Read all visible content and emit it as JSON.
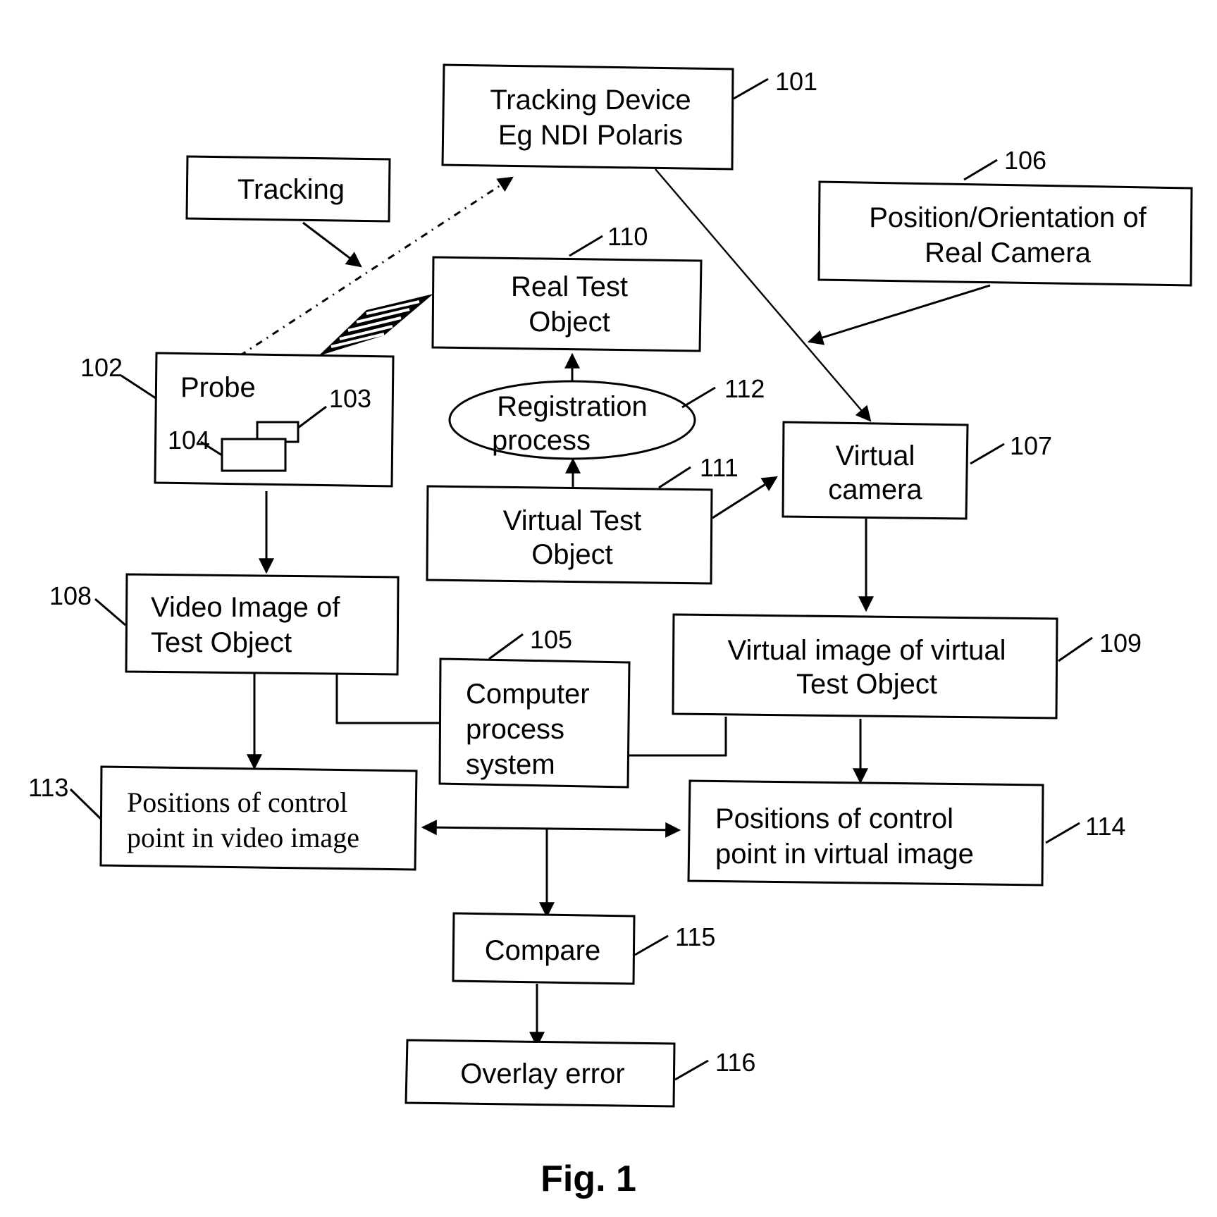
{
  "figure": {
    "caption": "Fig. 1"
  },
  "nodes": {
    "tracking_device": {
      "ref": "101",
      "lines": [
        "Tracking Device",
        "Eg NDI Polaris"
      ]
    },
    "tracking": {
      "lines": [
        "Tracking"
      ]
    },
    "position_orientation": {
      "ref": "106",
      "lines": [
        "Position/Orientation of",
        "Real Camera"
      ]
    },
    "real_test_object": {
      "ref": "110",
      "lines": [
        "Real Test",
        "Object"
      ]
    },
    "probe": {
      "ref": "102",
      "lines": [
        "Probe"
      ],
      "sub_refs": [
        "103",
        "104"
      ]
    },
    "registration": {
      "ref": "112",
      "lines": [
        "Registration",
        "process"
      ]
    },
    "virtual_camera": {
      "ref": "107",
      "lines": [
        "Virtual",
        "camera"
      ]
    },
    "virtual_test_object": {
      "ref": "111",
      "lines": [
        "Virtual Test",
        "Object"
      ]
    },
    "video_image": {
      "ref": "108",
      "lines": [
        "Video Image of",
        "Test Object"
      ]
    },
    "computer": {
      "ref": "105",
      "lines": [
        "Computer",
        "process",
        "system"
      ]
    },
    "virtual_image": {
      "ref": "109",
      "lines": [
        "Virtual image of virtual",
        "Test Object"
      ]
    },
    "positions_video": {
      "ref": "113",
      "lines": [
        "Positions of control",
        "point in video image"
      ]
    },
    "positions_virtual": {
      "ref": "114",
      "lines": [
        "Positions of control",
        "point in virtual image"
      ]
    },
    "compare": {
      "ref": "115",
      "lines": [
        "Compare"
      ]
    },
    "overlay_error": {
      "ref": "116",
      "lines": [
        "Overlay error"
      ]
    }
  },
  "edges": [
    {
      "from": "tracking",
      "to": "dotted-tracking-line",
      "type": "arrow"
    },
    {
      "from": "probe",
      "to": "tracking_device",
      "type": "dotted-arrow"
    },
    {
      "from": "probe",
      "to": "real_test_object",
      "type": "hatched-cable"
    },
    {
      "from": "tracking_device",
      "to": "virtual_camera",
      "type": "arrow"
    },
    {
      "from": "position_orientation",
      "to": "tracking-device-line",
      "type": "arrow"
    },
    {
      "from": "registration",
      "to": "real_test_object",
      "type": "arrow"
    },
    {
      "from": "virtual_test_object",
      "to": "registration",
      "type": "arrow"
    },
    {
      "from": "virtual_test_object",
      "to": "virtual_camera",
      "type": "arrow"
    },
    {
      "from": "probe",
      "to": "video_image",
      "type": "arrow"
    },
    {
      "from": "virtual_camera",
      "to": "virtual_image",
      "type": "arrow"
    },
    {
      "from": "video_image",
      "to": "computer",
      "type": "line"
    },
    {
      "from": "virtual_image",
      "to": "computer",
      "type": "line"
    },
    {
      "from": "video_image",
      "to": "positions_video",
      "type": "arrow"
    },
    {
      "from": "virtual_image",
      "to": "positions_virtual",
      "type": "arrow"
    },
    {
      "from": "positions_video",
      "to": "positions_virtual",
      "type": "double-arrow"
    },
    {
      "from": "positions_video+positions_virtual",
      "to": "compare",
      "type": "arrow"
    },
    {
      "from": "compare",
      "to": "overlay_error",
      "type": "arrow"
    }
  ]
}
